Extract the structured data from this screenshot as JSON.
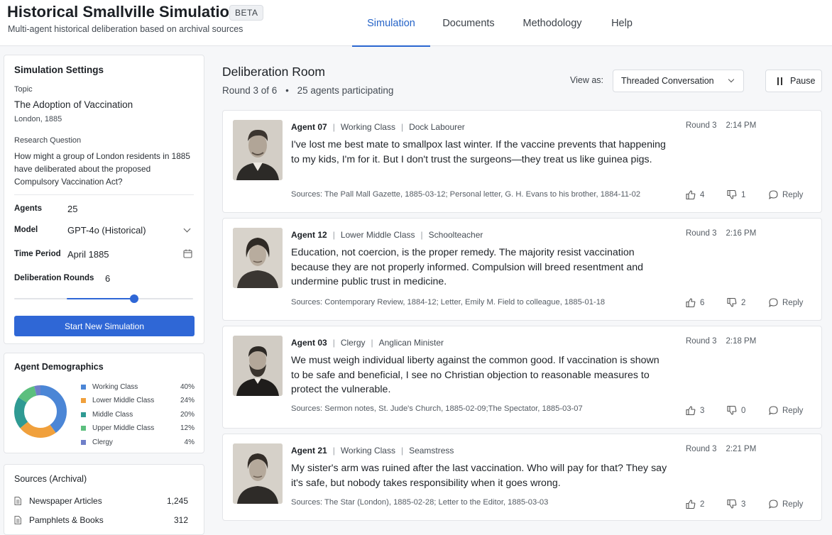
{
  "header": {
    "title": "Historical Smallville Simulation",
    "badge": "BETA",
    "subtitle": "Multi-agent historical deliberation based on archival sources",
    "nav": [
      {
        "label": "Simulation",
        "active": true
      },
      {
        "label": "Documents",
        "active": false
      },
      {
        "label": "Methodology",
        "active": false
      },
      {
        "label": "Help",
        "active": false
      }
    ]
  },
  "settings": {
    "heading": "Simulation Settings",
    "topic_label": "Topic",
    "topic": "The Adoption of Vaccination",
    "topic_sub": "London, 1885",
    "question_label": "Research Question",
    "question": "How might a group of London residents in 1885 have deliberated about the proposed Compulsory Vaccination Act?",
    "agents_label": "Agents",
    "agents_value": "25",
    "model_label": "Model",
    "model_value": "GPT-4o (Historical)",
    "period_label": "Time Period",
    "period_value": "April 1885",
    "rounds_label": "Deliberation Rounds",
    "rounds_value": "6",
    "rounds_slider_fraction": 0.5,
    "start_button": "Start New Simulation"
  },
  "demographics": {
    "heading": "Agent Demographics",
    "items": [
      {
        "label": "Working Class",
        "pct": "40%",
        "value": 40,
        "color": "#4b86d6"
      },
      {
        "label": "Lower Middle Class",
        "pct": "24%",
        "value": 24,
        "color": "#f0a03c"
      },
      {
        "label": "Middle Class",
        "pct": "20%",
        "value": 20,
        "color": "#2f9a93"
      },
      {
        "label": "Upper Middle Class",
        "pct": "12%",
        "value": 12,
        "color": "#5cbf7e"
      },
      {
        "label": "Clergy",
        "pct": "4%",
        "value": 4,
        "color": "#6f7fc9"
      }
    ]
  },
  "sources": {
    "heading": "Sources (Archival)",
    "items": [
      {
        "label": "Newspaper Articles",
        "count": "1,245"
      },
      {
        "label": "Pamphlets & Books",
        "count": "312"
      }
    ]
  },
  "room": {
    "title": "Deliberation Room",
    "round": "Round 3 of 6",
    "bullet": "•",
    "participants": "25 agents participating",
    "view_label": "View as:",
    "view_value": "Threaded Conversation",
    "pause_label": "Pause"
  },
  "messages": [
    {
      "agent": "Agent 07",
      "class": "Working Class",
      "role": "Dock Labourer",
      "round": "Round 3",
      "time": "2:14 PM",
      "text": "I've lost me best mate to smallpox last winter. If the vaccine prevents that happening to my kids, I'm for it. But I don't trust the surgeons—they treat us like guinea pigs.",
      "sources": "Sources: The Pall Mall Gazette, 1885-03-12; Personal letter, G. H. Evans to his brother, 1884-11-02",
      "likes": "4",
      "dislikes": "1",
      "reply": "Reply"
    },
    {
      "agent": "Agent 12",
      "class": "Lower Middle Class",
      "role": "Schoolteacher",
      "round": "Round 3",
      "time": "2:16 PM",
      "text": "Education, not coercion, is the proper remedy. The majority resist vaccination because they are not properly informed. Compulsion will breed resentment and undermine public trust in medicine.",
      "sources": "Sources: Contemporary Review, 1884-12; Letter, Emily M. Field to colleague, 1885-01-18",
      "likes": "6",
      "dislikes": "2",
      "reply": "Reply"
    },
    {
      "agent": "Agent 03",
      "class": "Clergy",
      "role": "Anglican Minister",
      "round": "Round 3",
      "time": "2:18 PM",
      "text": "We must weigh individual liberty against the common good. If vaccination is shown to be safe and beneficial, I see no Christian objection to reasonable measures to protect the vulnerable.",
      "sources": "Sources: Sermon notes, St. Jude's Church, 1885-02-09;The Spectator, 1885-03-07",
      "likes": "3",
      "dislikes": "0",
      "reply": "Reply"
    },
    {
      "agent": "Agent 21",
      "class": "Working Class",
      "role": "Seamstress",
      "round": "Round 3",
      "time": "2:21 PM",
      "text": "My sister's arm was ruined after the last vaccination. Who will pay for that? They say it's safe, but nobody takes responsibility when it goes wrong.",
      "sources": "Sources: The Star (London), 1885-02-28; Letter to the Editor, 1885-03-03",
      "likes": "2",
      "dislikes": "3",
      "reply": "Reply"
    }
  ]
}
